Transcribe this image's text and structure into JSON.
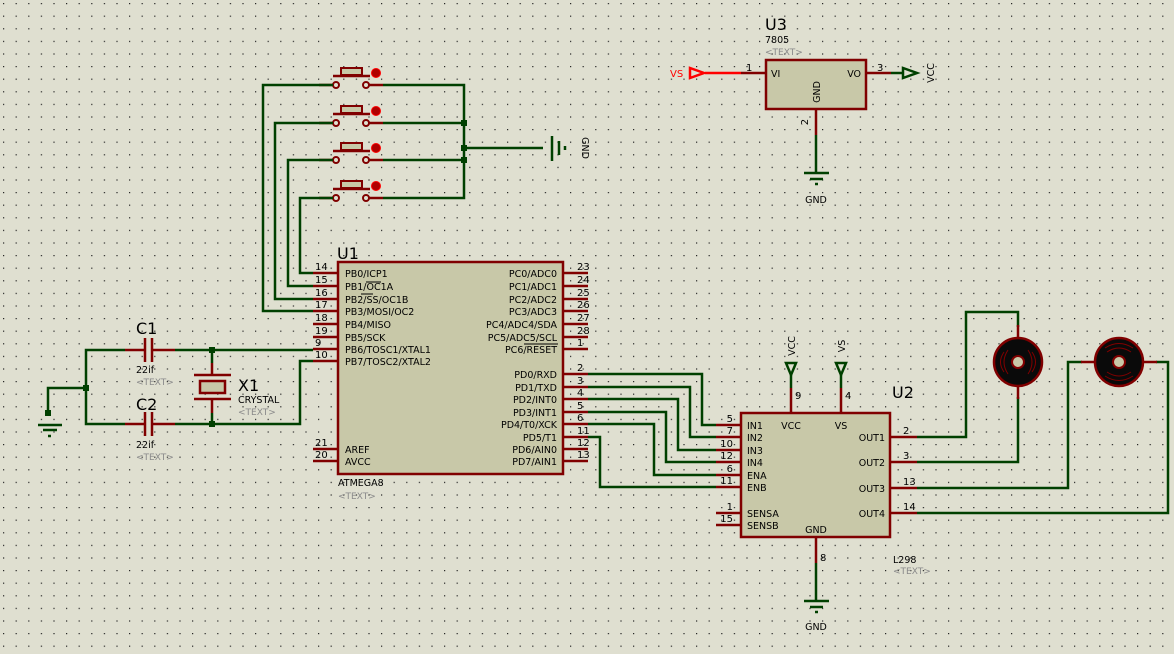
{
  "colors": {
    "background": "#dfdfd0",
    "wire": "#004000",
    "pin": "#800000",
    "body": "#c8c8a8",
    "vs_terminal": "#ff0000"
  },
  "u1": {
    "ref": "U1",
    "part": "ATMEGA8",
    "text": "<TEXT>",
    "left_pins": [
      {
        "num": "14",
        "label": "PB0/ICP1"
      },
      {
        "num": "15",
        "label": "PB1/OC1A"
      },
      {
        "num": "16",
        "label": "PB2/SS/OC1B"
      },
      {
        "num": "17",
        "label": "PB3/MOSI/OC2"
      },
      {
        "num": "18",
        "label": "PB4/MISO"
      },
      {
        "num": "19",
        "label": "PB5/SCK"
      },
      {
        "num": "9",
        "label": "PB6/TOSC1/XTAL1"
      },
      {
        "num": "10",
        "label": "PB7/TOSC2/XTAL2"
      },
      {
        "num": "21",
        "label": "AREF"
      },
      {
        "num": "20",
        "label": "AVCC"
      }
    ],
    "right_pins": [
      {
        "num": "23",
        "label": "PC0/ADC0"
      },
      {
        "num": "24",
        "label": "PC1/ADC1"
      },
      {
        "num": "25",
        "label": "PC2/ADC2"
      },
      {
        "num": "26",
        "label": "PC3/ADC3"
      },
      {
        "num": "27",
        "label": "PC4/ADC4/SDA"
      },
      {
        "num": "28",
        "label": "PC5/ADC5/SCL"
      },
      {
        "num": "1",
        "label": "PC6/RESET"
      },
      {
        "num": "2",
        "label": "PD0/RXD"
      },
      {
        "num": "3",
        "label": "PD1/TXD"
      },
      {
        "num": "4",
        "label": "PD2/INT0"
      },
      {
        "num": "5",
        "label": "PD3/INT1"
      },
      {
        "num": "6",
        "label": "PD4/T0/XCK"
      },
      {
        "num": "11",
        "label": "PD5/T1"
      },
      {
        "num": "12",
        "label": "PD6/AIN0"
      },
      {
        "num": "13",
        "label": "PD7/AIN1"
      }
    ]
  },
  "u2": {
    "ref": "U2",
    "part": "L298",
    "text": "<TEXT>",
    "left_pins": [
      {
        "num": "5",
        "label": "IN1"
      },
      {
        "num": "7",
        "label": "IN2"
      },
      {
        "num": "10",
        "label": "IN3"
      },
      {
        "num": "12",
        "label": "IN4"
      },
      {
        "num": "6",
        "label": "ENA"
      },
      {
        "num": "11",
        "label": "ENB"
      },
      {
        "num": "1",
        "label": "SENSA"
      },
      {
        "num": "15",
        "label": "SENSB"
      }
    ],
    "right_pins": [
      {
        "num": "2",
        "label": "OUT1"
      },
      {
        "num": "3",
        "label": "OUT2"
      },
      {
        "num": "13",
        "label": "OUT3"
      },
      {
        "num": "14",
        "label": "OUT4"
      }
    ],
    "top_pins": [
      {
        "num": "9",
        "label": "VCC",
        "terminal": "VCC"
      },
      {
        "num": "4",
        "label": "VS",
        "terminal": "VS"
      }
    ],
    "bottom_pin": {
      "num": "8",
      "label": "GND",
      "terminal": "GND"
    }
  },
  "u3": {
    "ref": "U3",
    "part": "7805",
    "text": "<TEXT>",
    "vi": "VI",
    "vo": "VO",
    "gnd": "GND",
    "pin_vi": "1",
    "pin_vo": "3",
    "pin_gnd": "2",
    "in_terminal": "VS",
    "out_terminal": "VCC",
    "gnd_terminal": "GND"
  },
  "c1": {
    "ref": "C1",
    "value": "22if",
    "text": "<TEXT>"
  },
  "c2": {
    "ref": "C2",
    "value": "22if",
    "text": "<TEXT>"
  },
  "x1": {
    "ref": "X1",
    "value": "CRYSTAL",
    "text": "<TEXT>"
  },
  "buttons_gnd": "GND"
}
